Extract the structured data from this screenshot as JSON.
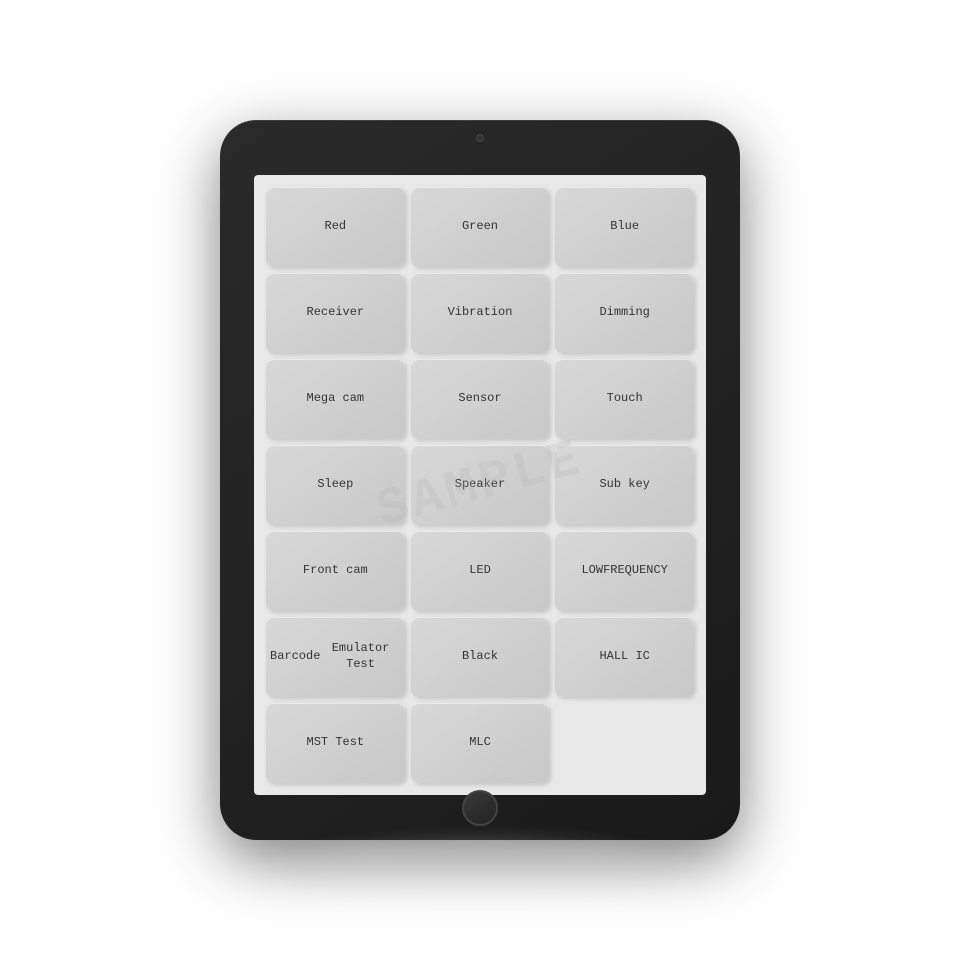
{
  "tablet": {
    "watermark": "SAMPLE"
  },
  "buttons": [
    {
      "label": "Red",
      "id": "btn-red"
    },
    {
      "label": "Green",
      "id": "btn-green"
    },
    {
      "label": "Blue",
      "id": "btn-blue"
    },
    {
      "label": "Receiver",
      "id": "btn-receiver"
    },
    {
      "label": "Vibration",
      "id": "btn-vibration"
    },
    {
      "label": "Dimming",
      "id": "btn-dimming"
    },
    {
      "label": "Mega cam",
      "id": "btn-mega-cam"
    },
    {
      "label": "Sensor",
      "id": "btn-sensor"
    },
    {
      "label": "Touch",
      "id": "btn-touch"
    },
    {
      "label": "Sleep",
      "id": "btn-sleep"
    },
    {
      "label": "Speaker",
      "id": "btn-speaker"
    },
    {
      "label": "Sub key",
      "id": "btn-sub-key"
    },
    {
      "label": "Front cam",
      "id": "btn-front-cam"
    },
    {
      "label": "LED",
      "id": "btn-led"
    },
    {
      "label": "LOW\nFREQUENCY",
      "id": "btn-low-frequency"
    },
    {
      "label": "Barcode\nEmulator Test",
      "id": "btn-barcode"
    },
    {
      "label": "Black",
      "id": "btn-black"
    },
    {
      "label": "HALL IC",
      "id": "btn-hall-ic"
    },
    {
      "label": "MST Test",
      "id": "btn-mst-test"
    },
    {
      "label": "MLC",
      "id": "btn-mlc"
    },
    {
      "label": "",
      "id": "btn-empty"
    }
  ]
}
